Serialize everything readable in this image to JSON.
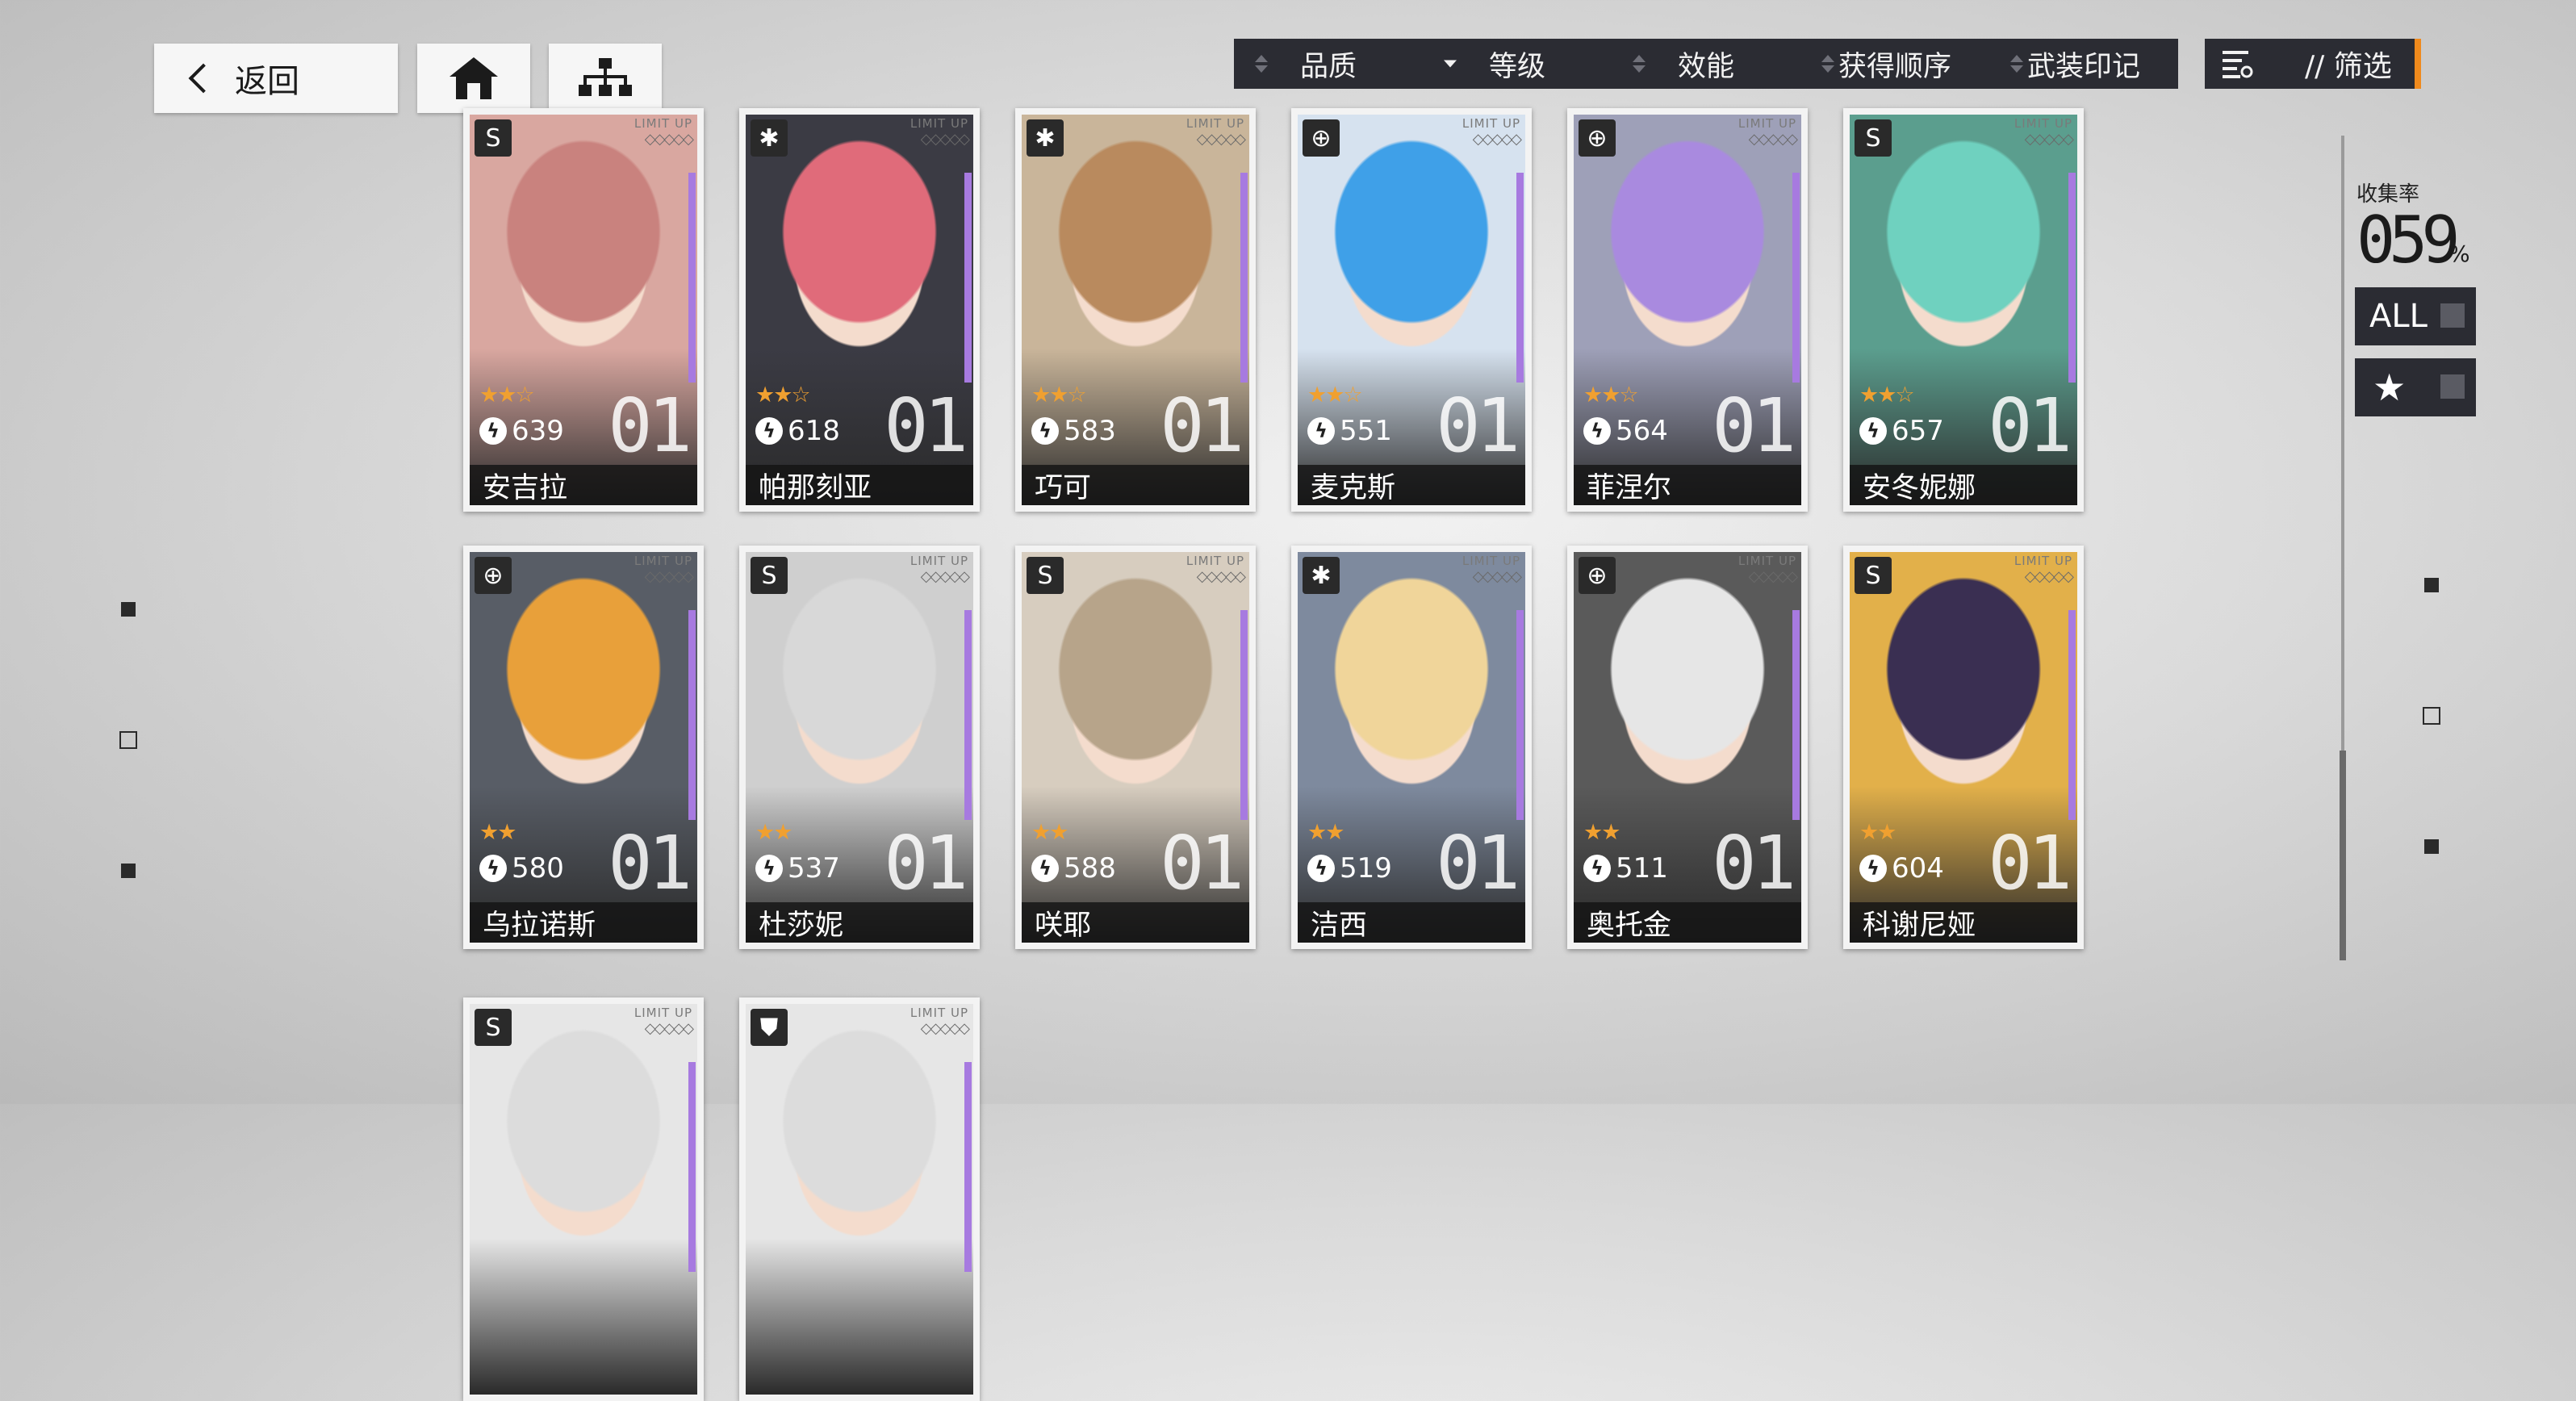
{
  "nav": {
    "back_label": "返回"
  },
  "sort": [
    {
      "label": "品质",
      "active": false
    },
    {
      "label": "等级",
      "active": true
    },
    {
      "label": "效能",
      "active": false
    },
    {
      "label": "获得顺序",
      "active": false
    },
    {
      "label": "武装印记",
      "active": false
    }
  ],
  "filter": {
    "label": "// 筛选",
    "accent": "#f08a1c"
  },
  "card_tag": "LIMIT UP",
  "characters": [
    {
      "name": "安吉拉",
      "power": "639",
      "level": "01",
      "stars": 2,
      "class_icon": "s-icon",
      "bg": "#d9a7a0",
      "hair": "#c9827e"
    },
    {
      "name": "帕那刻亚",
      "power": "618",
      "level": "01",
      "stars": 2,
      "class_icon": "asterisk-icon",
      "bg": "#3b3b44",
      "hair": "#e06b7a"
    },
    {
      "name": "巧可",
      "power": "583",
      "level": "01",
      "stars": 2,
      "class_icon": "asterisk-icon",
      "bg": "#c9b59a",
      "hair": "#b98a5e"
    },
    {
      "name": "麦克斯",
      "power": "551",
      "level": "01",
      "stars": 2,
      "class_icon": "crosshair-icon",
      "bg": "#d6e2ef",
      "hair": "#3fa0e8"
    },
    {
      "name": "菲涅尔",
      "power": "564",
      "level": "01",
      "stars": 2,
      "class_icon": "crosshair-icon",
      "bg": "#9ea0b8",
      "hair": "#a98adf"
    },
    {
      "name": "安冬妮娜",
      "power": "657",
      "level": "01",
      "stars": 2,
      "class_icon": "s-icon",
      "bg": "#5b9e8e",
      "hair": "#6fd1bf"
    },
    {
      "name": "乌拉诺斯",
      "power": "580",
      "level": "01",
      "stars": 2,
      "class_icon": "crosshair-icon",
      "bg": "#585d66",
      "hair": "#e8a03a"
    },
    {
      "name": "杜莎妮",
      "power": "537",
      "level": "01",
      "stars": 2,
      "class_icon": "s-icon",
      "bg": "#cfcfcf",
      "hair": "#d8d8d8"
    },
    {
      "name": "咲耶",
      "power": "588",
      "level": "01",
      "stars": 2,
      "class_icon": "s-icon",
      "bg": "#d7cdbf",
      "hair": "#b7a48a"
    },
    {
      "name": "洁西",
      "power": "519",
      "level": "01",
      "stars": 2,
      "class_icon": "asterisk-icon",
      "bg": "#7e8a9e",
      "hair": "#f0d59a"
    },
    {
      "name": "奥托金",
      "power": "511",
      "level": "01",
      "stars": 2,
      "class_icon": "crosshair-icon",
      "bg": "#5a5a5a",
      "hair": "#e6e6e6"
    },
    {
      "name": "科谢尼娅",
      "power": "604",
      "level": "01",
      "stars": 2,
      "class_icon": "s-icon",
      "bg": "#e2b04a",
      "hair": "#3a2f52"
    },
    {
      "name": "",
      "power": "",
      "level": "",
      "stars": 0,
      "class_icon": "s-icon",
      "bg": "#e6e6e6",
      "hair": "#dcdcdc"
    },
    {
      "name": "",
      "power": "",
      "level": "",
      "stars": 0,
      "class_icon": "shield-icon",
      "bg": "#e6e6e6",
      "hair": "#dcdcdc"
    }
  ],
  "collection": {
    "label": "收集率",
    "value": "059",
    "unit": "%"
  },
  "toggles": {
    "all_label": "ALL",
    "star_label": "★"
  },
  "colors": {
    "dark_panel": "#2b2c33",
    "star": "#f0a030",
    "rarity_bar": "#a77ae0"
  }
}
